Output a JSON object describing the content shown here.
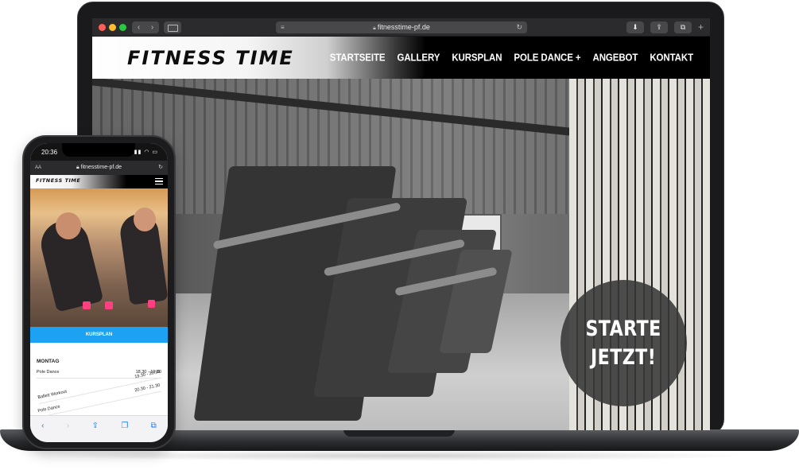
{
  "laptop": {
    "browser": {
      "url": "fitnesstime-pf.de",
      "icons": [
        "back-icon",
        "forward-icon",
        "sidebar-icon",
        "reader-icon",
        "lock-icon",
        "reload-icon",
        "download-icon",
        "share-icon",
        "tabs-icon",
        "new-tab-icon"
      ]
    },
    "site": {
      "logo_text": "FITNESS TIME",
      "nav": [
        "STARTSEITE",
        "GALLERY",
        "KURSPLAN",
        "POLE DANCE +",
        "ANGEBOT",
        "KONTAKT"
      ],
      "cta": {
        "line1": "STARTE",
        "line2": "JETZT!"
      }
    }
  },
  "phone": {
    "status": {
      "time": "20:36"
    },
    "browser": {
      "url": "fitnesstime-pf.de",
      "text_size_label": "AA"
    },
    "site": {
      "logo_text": "FITNESS TIME",
      "kursplan_button": "KURSPLAN",
      "schedule": {
        "day": "MONTAG",
        "rows": [
          {
            "name": "Pole Dance",
            "time": "18.30 - 19.30"
          },
          {
            "name": "Ballett Workout",
            "time": "19.30 - 20.30"
          },
          {
            "name": "Pole Dance",
            "time": "20.30 - 21.30"
          }
        ]
      }
    },
    "toolbar_icons": [
      "back-icon",
      "forward-icon",
      "share-icon",
      "bookmarks-icon",
      "tabs-icon"
    ]
  },
  "colors": {
    "accent_blue": "#1da1f2",
    "logo_bolt": "#1e88e5",
    "header_black": "#000000",
    "traffic_red": "#ff5f57",
    "traffic_yellow": "#febc2e",
    "traffic_green": "#28c840"
  }
}
